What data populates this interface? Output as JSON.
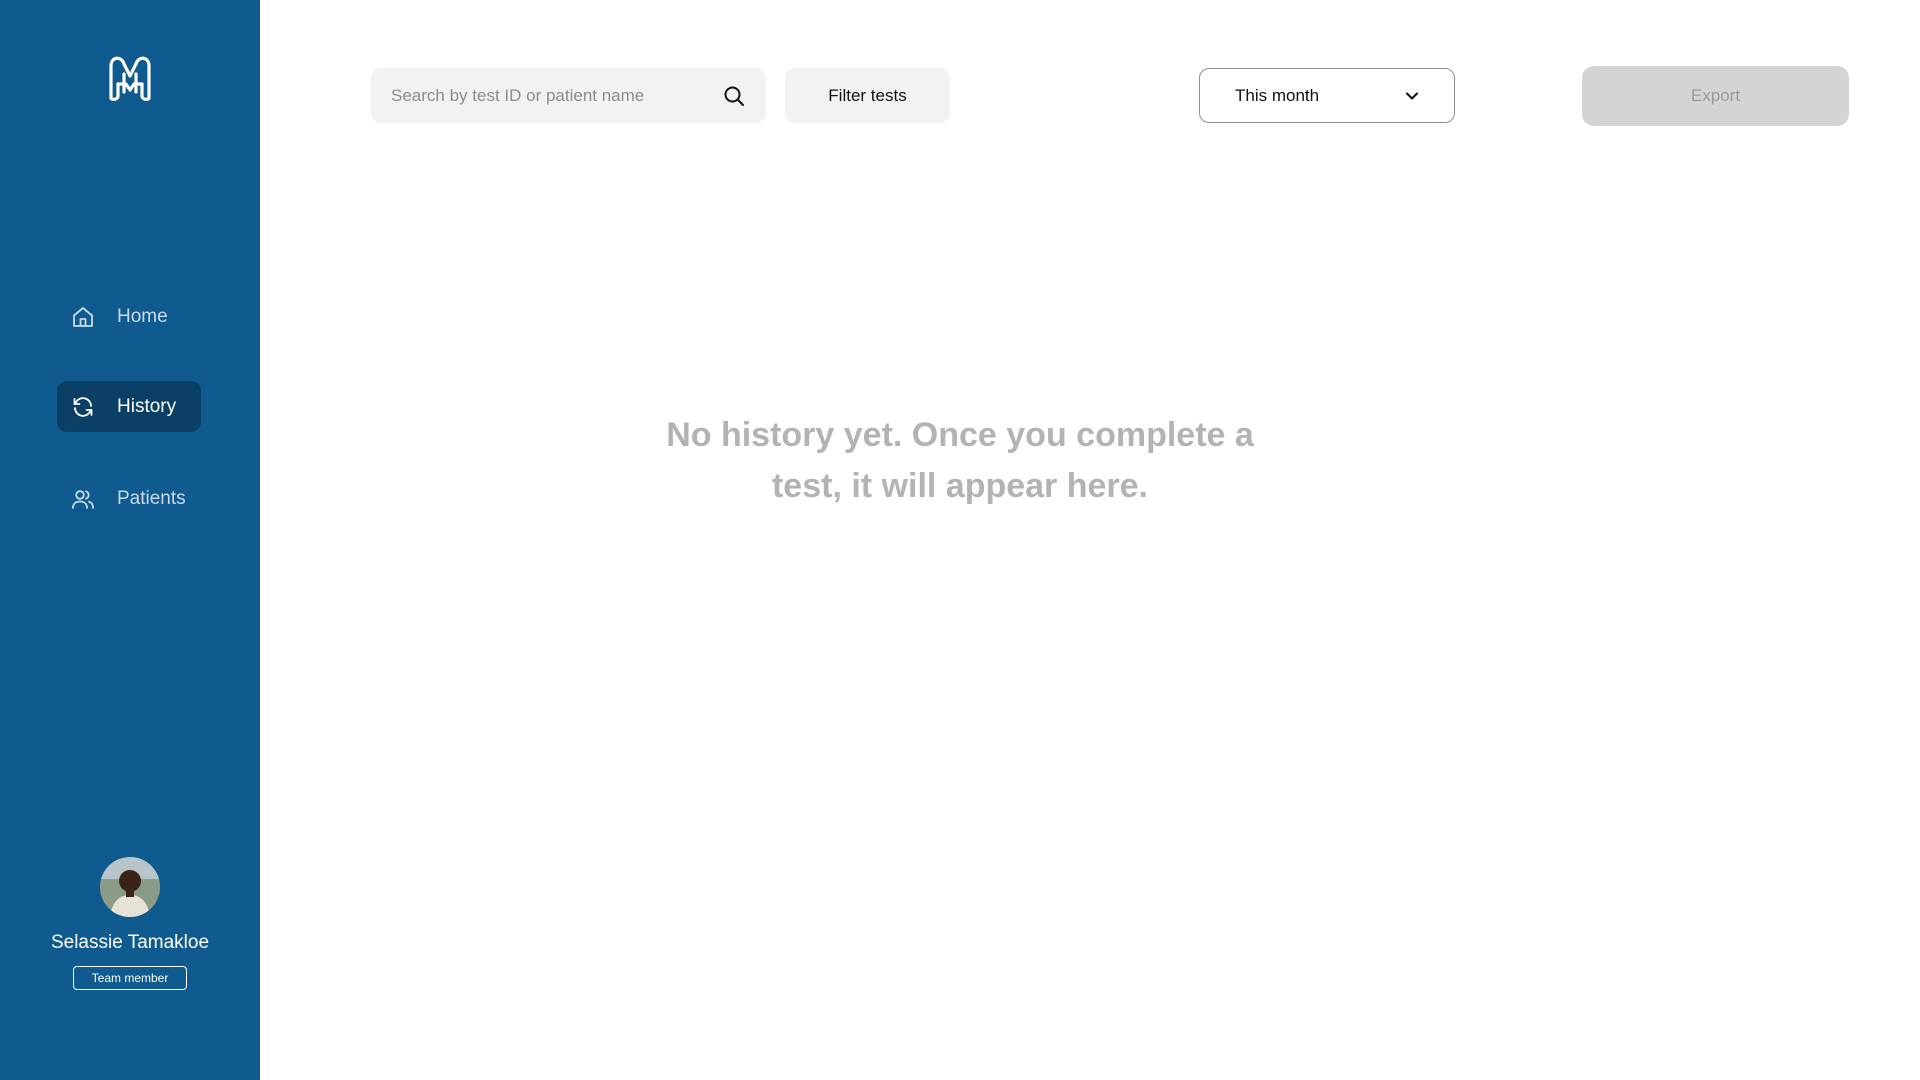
{
  "sidebar": {
    "logo_icon": "brand-logo-icon",
    "nav": [
      {
        "label": "Home",
        "icon": "home-icon",
        "active": false
      },
      {
        "label": "History",
        "icon": "refresh-icon",
        "active": true
      },
      {
        "label": "Patients",
        "icon": "users-icon",
        "active": false
      }
    ],
    "user": {
      "name": "Selassie Tamakloe",
      "role": "Team member"
    }
  },
  "toolbar": {
    "search": {
      "placeholder": "Search by test ID or patient name",
      "value": ""
    },
    "filter_label": "Filter tests",
    "period": {
      "selected": "This month"
    },
    "export_label": "Export"
  },
  "main": {
    "empty_message": "No history yet. Once you complete a test, it will appear here."
  },
  "colors": {
    "sidebar_bg": "#0f5a8f",
    "nav_active_bg": "#0b3f66",
    "export_disabled_bg": "#d4d4d4"
  }
}
